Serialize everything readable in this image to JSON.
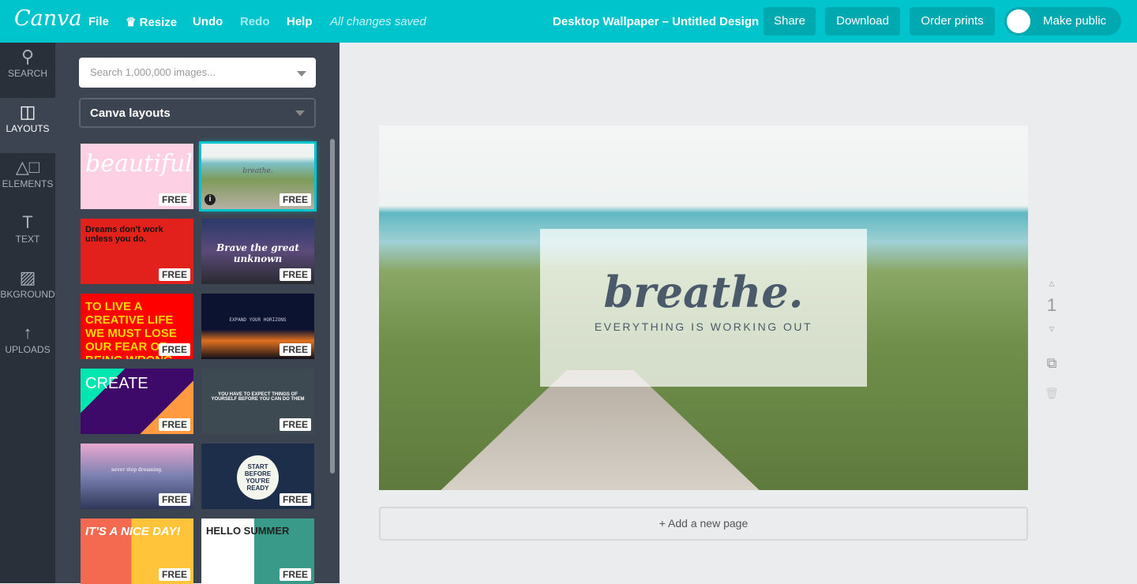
{
  "topbar": {
    "logo": "Canva",
    "file": "File",
    "resize": "Resize",
    "undo": "Undo",
    "redo": "Redo",
    "help": "Help",
    "status": "All changes saved",
    "title": "Desktop Wallpaper – Untitled Design",
    "share": "Share",
    "download": "Download",
    "order_prints": "Order prints",
    "make_public": "Make public",
    "accent": "#00c4cc"
  },
  "rail": [
    {
      "label": "SEARCH",
      "icon": "search-icon"
    },
    {
      "label": "LAYOUTS",
      "icon": "layout-icon"
    },
    {
      "label": "ELEMENTS",
      "icon": "shapes-icon"
    },
    {
      "label": "TEXT",
      "icon": "text-icon"
    },
    {
      "label": "BKGROUND",
      "icon": "background-icon"
    },
    {
      "label": "UPLOADS",
      "icon": "upload-icon"
    }
  ],
  "panel": {
    "search_placeholder": "Search 1,000,000 images...",
    "select": "Canva layouts",
    "badge": "FREE",
    "layouts": [
      {
        "text": "beautiful"
      },
      {
        "text": "breathe."
      },
      {
        "text": "Dreams don't work unless you do."
      },
      {
        "text": "Brave the great unknown"
      },
      {
        "text": "TO LIVE A CREATIVE LIFE WE MUST LOSE OUR FEAR OF BEING WRONG"
      },
      {
        "text": "EXPAND YOUR HORIZONS"
      },
      {
        "text": "CREATE"
      },
      {
        "text": "YOU HAVE TO EXPECT THINGS OF YOURSELF BEFORE YOU CAN DO THEM"
      },
      {
        "text": "never stop dreaming."
      },
      {
        "text": "START BEFORE YOU'RE READY"
      },
      {
        "text": "IT'S A NICE DAY!"
      },
      {
        "text": "HELLO SUMMER"
      }
    ]
  },
  "design": {
    "heading": "breathe.",
    "subheading": "EVERYTHING IS WORKING OUT"
  },
  "page_number": "1",
  "add_page": "+ Add a new page"
}
